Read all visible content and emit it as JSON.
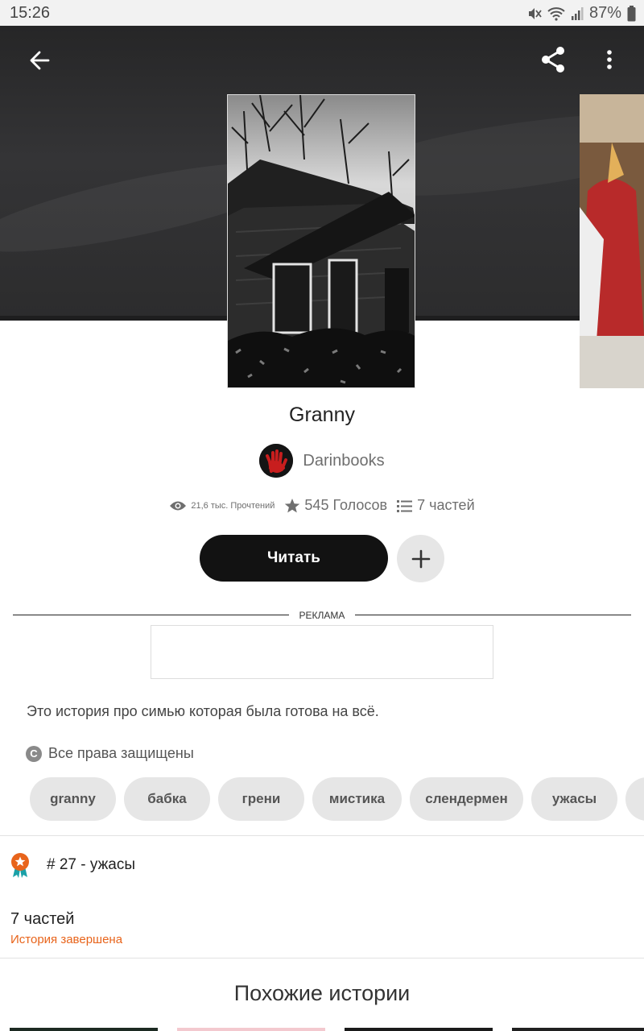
{
  "status_bar": {
    "time": "15:26",
    "battery": "87%",
    "icons": [
      "mute-icon",
      "wifi-icon",
      "signal-icon",
      "battery-icon"
    ]
  },
  "toolbar": {
    "back_icon": "back-arrow-icon",
    "share_icon": "share-icon",
    "more_icon": "more-vert-icon"
  },
  "story": {
    "title": "Granny",
    "author": "Darinbooks",
    "reads": "21,6 тыс. Прочтений",
    "votes": "545 Голосов",
    "parts": "7 частей",
    "read_button": "Читать",
    "add_icon": "plus-icon",
    "description": "Это история про симью которая была готова на всё.",
    "rights": "Все права защищены",
    "rights_icon": "copyright-icon"
  },
  "ad": {
    "label": "РЕКЛАМА"
  },
  "tags": [
    "granny",
    "бабка",
    "грени",
    "мистика",
    "слендермен",
    "ужасы"
  ],
  "ranking": {
    "icon": "ribbon-award-icon",
    "text": "# 27 - ужасы"
  },
  "parts_info": {
    "count": "7 частей",
    "status": "История завершена"
  },
  "similar": {
    "heading": "Похожие истории"
  },
  "colors": {
    "accent": "#e8641b",
    "button_dark": "#121212",
    "chip_bg": "#e6e6e6"
  }
}
